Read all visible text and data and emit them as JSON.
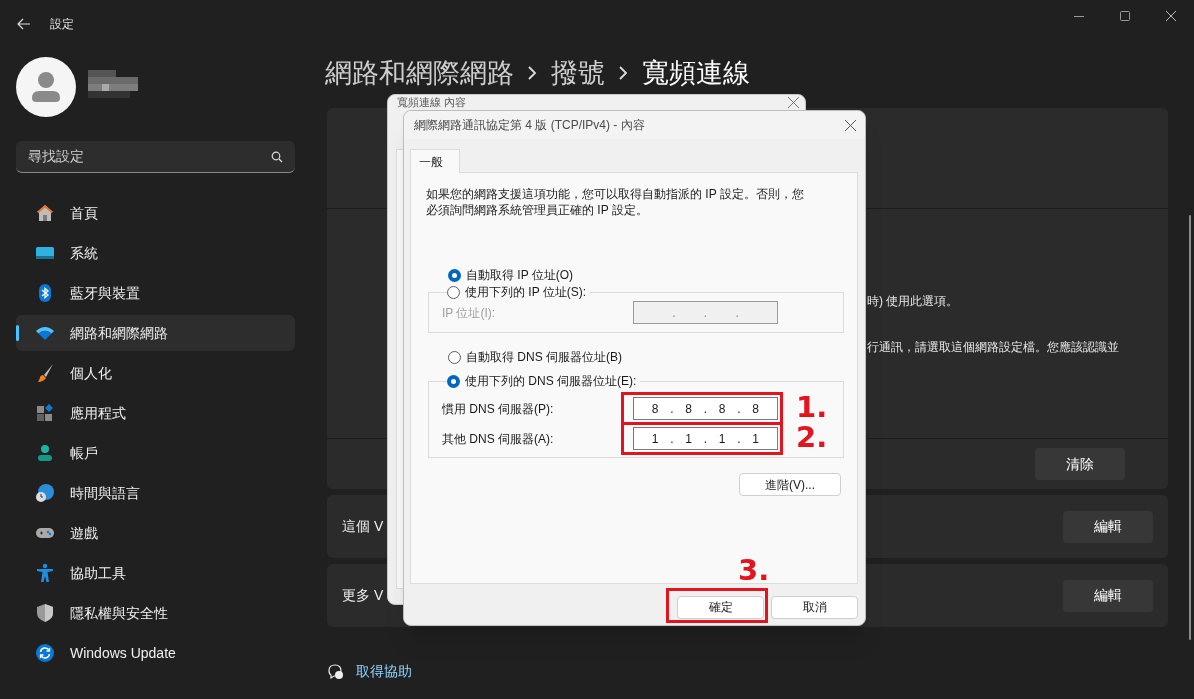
{
  "window": {
    "title": "設定"
  },
  "search": {
    "placeholder": "尋找設定"
  },
  "nav": [
    {
      "label": "首頁",
      "kind": "home",
      "selected": false
    },
    {
      "label": "系統",
      "kind": "system",
      "selected": false
    },
    {
      "label": "藍牙與裝置",
      "kind": "bluetooth",
      "selected": false
    },
    {
      "label": "網路和網際網路",
      "kind": "wifi",
      "selected": true
    },
    {
      "label": "個人化",
      "kind": "brush",
      "selected": false
    },
    {
      "label": "應用程式",
      "kind": "apps",
      "selected": false
    },
    {
      "label": "帳戶",
      "kind": "account",
      "selected": false
    },
    {
      "label": "時間與語言",
      "kind": "time",
      "selected": false
    },
    {
      "label": "遊戲",
      "kind": "gamepad",
      "selected": false
    },
    {
      "label": "協助工具",
      "kind": "accessibility",
      "selected": false
    },
    {
      "label": "隱私權與安全性",
      "kind": "shield",
      "selected": false
    },
    {
      "label": "Windows Update",
      "kind": "update",
      "selected": false
    }
  ],
  "breadcrumb": [
    "網路和網際網路",
    "撥號",
    "寬頻連線"
  ],
  "card_texts": [
    "時) 使用此選項。",
    "行通訊，請選取這個網路設定檔。您應該認識並"
  ],
  "clear_button": "清除",
  "rows": [
    {
      "label": "這個 V",
      "button": "編輯"
    },
    {
      "label": "更多 V",
      "button": "編輯"
    }
  ],
  "help_link": "取得協助",
  "back_dialog": {
    "title": "寬頻連線 內容"
  },
  "dialog": {
    "title": "網際網路通訊協定第 4 版 (TCP/IPv4) - 內容",
    "tabs": [
      {
        "label": "一般",
        "selected": true
      }
    ],
    "description": "如果您的網路支援這項功能，您可以取得自動指派的 IP 設定。否則，您必須詢問網路系統管理員正確的 IP 設定。",
    "ip_options": [
      {
        "label": "自動取得 IP 位址(O)",
        "selected": true
      },
      {
        "label": "使用下列的 IP 位址(S):",
        "selected": false
      }
    ],
    "ip_fields": [
      {
        "label": "IP 位址(I):",
        "disabled": true,
        "parts": [
          ".",
          ".",
          "."
        ]
      }
    ],
    "dns_options": [
      {
        "label": "自動取得 DNS 伺服器位址(B)",
        "selected": false
      },
      {
        "label": "使用下列的 DNS 伺服器位址(E):",
        "selected": true
      }
    ],
    "dns_fields": [
      {
        "label": "慣用 DNS 伺服器(P):",
        "disabled": false,
        "parts": [
          "8",
          ".",
          "8",
          ".",
          "8",
          ".",
          "8"
        ],
        "annotation": "1."
      },
      {
        "label": "其他 DNS 伺服器(A):",
        "disabled": false,
        "parts": [
          "1",
          ".",
          "1",
          ".",
          "1",
          ".",
          "1"
        ],
        "annotation": "2."
      }
    ],
    "advanced_button": "進階(V)...",
    "buttons": [
      {
        "label": "確定",
        "annotation": "3."
      },
      {
        "label": "取消"
      }
    ]
  }
}
